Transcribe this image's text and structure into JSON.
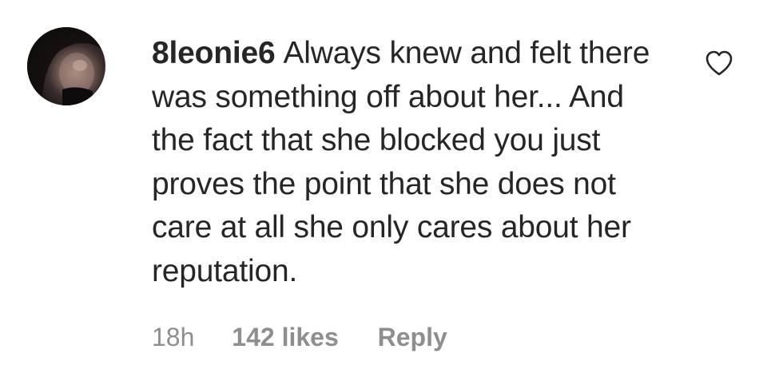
{
  "comment": {
    "username": "8leonie6",
    "text": "Always knew and felt there was something off about her... And the fact that she blocked you just proves the point that she does not care at all she only cares about her reputation.",
    "timestamp": "18h",
    "likes": "142 likes",
    "reply_label": "Reply",
    "like_icon": "heart-outline-icon"
  },
  "colors": {
    "text": "#262626",
    "secondary": "#8e8e8e",
    "background": "#ffffff"
  }
}
